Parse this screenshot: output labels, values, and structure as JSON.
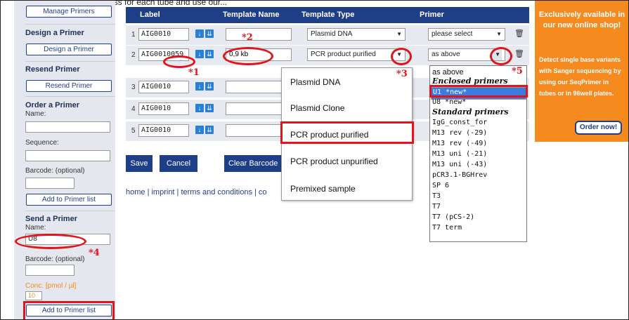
{
  "top_cut_text": "address for each tube and use our...",
  "sidebar": {
    "manage_btn": "Manage Primers",
    "design_head": "Design a Primer",
    "design_btn": "Design a Primer",
    "resend_head": "Resend Primer",
    "resend_btn": "Resend Primer",
    "order_head": "Order a Primer",
    "order_name_lbl": "Name:",
    "order_seq_lbl": "Sequence:",
    "order_barcode_lbl": "Barcode: (optional)",
    "order_add_btn": "Add to Primer list",
    "send_head": "Send a Primer",
    "send_name_lbl": "Name:",
    "send_name_val": "U8",
    "send_barcode_lbl": "Barcode: (optional)",
    "send_conc_lbl": "Conc. [pmol / µl]",
    "send_conc_val": "10",
    "send_add_btn": "Add to Primer list"
  },
  "table": {
    "headers": {
      "label": "Label",
      "template_name": "Template Name",
      "template_type": "Template Type",
      "primer": "Primer"
    },
    "rows": [
      {
        "num": "1",
        "label": "AIG0010",
        "template_name": "",
        "template_type": "Plasmid DNA",
        "primer": "please select"
      },
      {
        "num": "2",
        "label": "AIG0010059",
        "template_name": "0,9 kb",
        "template_type": "PCR product purified",
        "primer": "as above"
      },
      {
        "num": "3",
        "label": "AIG0010"
      },
      {
        "num": "4",
        "label": "AIG0010"
      },
      {
        "num": "5",
        "label": "AIG0010"
      }
    ],
    "actions": {
      "save": "Save",
      "cancel": "Cancel",
      "clear_barcode": "Clear Barcode"
    }
  },
  "footer_text": "home | imprint | terms and conditions | co",
  "type_dropdown": [
    "Plasmid DNA",
    "Plasmid Clone",
    "PCR product purified",
    "PCR product unpurified",
    "Premixed sample"
  ],
  "primer_list": [
    {
      "text": "as above",
      "kind": "item"
    },
    {
      "text": "Enclosed primers",
      "kind": "group"
    },
    {
      "text": "U1 *new*",
      "kind": "selected"
    },
    {
      "text": "U8 *new*",
      "kind": "item"
    },
    {
      "text": "Standard primers",
      "kind": "group"
    },
    {
      "text": "IgG_const_for",
      "kind": "item"
    },
    {
      "text": "M13 rev (-29)",
      "kind": "item"
    },
    {
      "text": "M13 rev (-49)",
      "kind": "item"
    },
    {
      "text": "M13 uni (-21)",
      "kind": "item"
    },
    {
      "text": "M13 uni (-43)",
      "kind": "item"
    },
    {
      "text": "pCR3.1-BGHrev",
      "kind": "item"
    },
    {
      "text": "SP 6",
      "kind": "item"
    },
    {
      "text": "T3",
      "kind": "item"
    },
    {
      "text": "T7",
      "kind": "item"
    },
    {
      "text": "T7 (pCS-2)",
      "kind": "item"
    },
    {
      "text": "T7 term",
      "kind": "item"
    }
  ],
  "ad": {
    "headline": "Exclusively available in our new online shop!",
    "body": "Detect single base variants with Sanger sequencing by using our SeqPrimer in tubes or in 96well plates.",
    "button": "Order now!"
  },
  "annotations": {
    "a1": "*1",
    "a2": "*2",
    "a3": "*3",
    "a4": "*4",
    "a5": "*5"
  },
  "colors": {
    "nav": "#1f3e88",
    "accent": "#f58a1f",
    "highlight": "#e0141a",
    "selection": "#3b7ce0"
  }
}
